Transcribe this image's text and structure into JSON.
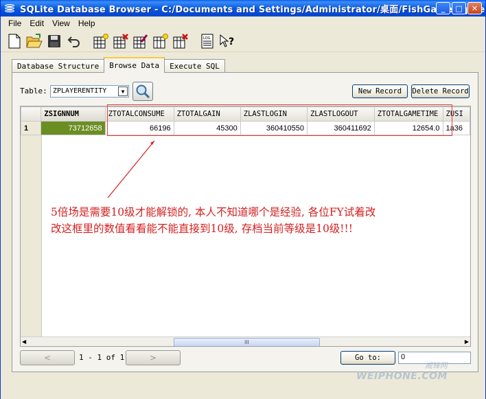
{
  "window": {
    "title": "SQLite Database Browser - C:/Documents and Settings/Administrator/桌面/FishGame.sqlite",
    "min_glyph": "_",
    "max_glyph": "□",
    "close_glyph": "✕"
  },
  "menu": [
    {
      "label": "File"
    },
    {
      "label": "Edit"
    },
    {
      "label": "View"
    },
    {
      "label": "Help"
    }
  ],
  "tabs": [
    {
      "label": "Database Structure"
    },
    {
      "label": "Browse Data"
    },
    {
      "label": "Execute SQL"
    }
  ],
  "browse": {
    "table_label": "Table:",
    "table_value": "ZPLAYERENTITY",
    "new_record_label": "New Record",
    "delete_record_label": "Delete Record",
    "columns": [
      "ZSIGNNUM",
      "ZTOTALCONSUME",
      "ZTOTALGAIN",
      "ZLASTLOGIN",
      "ZLASTLOGOUT",
      "ZTOTALGAMETIME",
      "ZUSI"
    ],
    "rows": [
      {
        "num": "1",
        "cells": [
          "73712658",
          "66196",
          "45300",
          "360410550",
          "360411692",
          "12654.0",
          "1a36"
        ]
      }
    ],
    "scroll_thumb_glyph": "III",
    "pager_text": "1 - 1 of 1",
    "prev_glyph": "<",
    "next_glyph": ">",
    "goto_label": "Go to:",
    "goto_value": "0"
  },
  "annotation": {
    "line1": "5倍场是需要10级才能解锁的, 本人不知道哪个是经验, 各位FY试着改",
    "line2": "改这框里的数值看看能不能直接到10级, 存档当前等级是10级!!!",
    "color": "#d42020"
  },
  "watermark": {
    "top": "威锋网",
    "bottom": "WEIPHONE.COM"
  }
}
